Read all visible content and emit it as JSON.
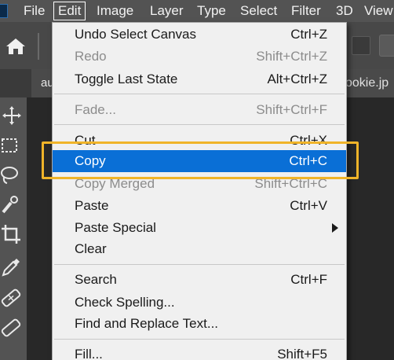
{
  "menubar": {
    "items": [
      {
        "label": "File",
        "active": false
      },
      {
        "label": "Edit",
        "active": true
      },
      {
        "label": "Image",
        "active": false
      },
      {
        "label": "Layer",
        "active": false
      },
      {
        "label": "Type",
        "active": false
      },
      {
        "label": "Select",
        "active": false
      },
      {
        "label": "Filter",
        "active": false
      },
      {
        "label": "3D",
        "active": false
      },
      {
        "label": "View",
        "active": false
      }
    ]
  },
  "tabs": {
    "left_label": "au",
    "right_label": "ookie.jp"
  },
  "toolbar": {
    "tools": [
      "move-tool-icon",
      "marquee-tool-icon",
      "lasso-tool-icon",
      "quick-selection-tool-icon",
      "crop-tool-icon",
      "eyedropper-tool-icon",
      "healing-brush-tool-icon",
      "brush-tool-icon"
    ]
  },
  "edit_menu": {
    "items": [
      {
        "label": "Undo Select Canvas",
        "shortcut": "Ctrl+Z",
        "enabled": true
      },
      {
        "label": "Redo",
        "shortcut": "Shift+Ctrl+Z",
        "enabled": false
      },
      {
        "label": "Toggle Last State",
        "shortcut": "Alt+Ctrl+Z",
        "enabled": true
      },
      {
        "label": "Fade...",
        "shortcut": "Shift+Ctrl+F",
        "enabled": false
      },
      {
        "label": "Cut",
        "shortcut": "Ctrl+X",
        "enabled": true
      },
      {
        "label": "Copy",
        "shortcut": "Ctrl+C",
        "enabled": true,
        "highlighted": true
      },
      {
        "label": "Copy Merged",
        "shortcut": "Shift+Ctrl+C",
        "enabled": false
      },
      {
        "label": "Paste",
        "shortcut": "Ctrl+V",
        "enabled": true
      },
      {
        "label": "Paste Special",
        "shortcut": "",
        "enabled": true,
        "submenu": true
      },
      {
        "label": "Clear",
        "shortcut": "",
        "enabled": true
      },
      {
        "label": "Search",
        "shortcut": "Ctrl+F",
        "enabled": true
      },
      {
        "label": "Check Spelling...",
        "shortcut": "",
        "enabled": true
      },
      {
        "label": "Find and Replace Text...",
        "shortcut": "",
        "enabled": true
      },
      {
        "label": "Fill...",
        "shortcut": "Shift+F5",
        "enabled": true
      }
    ]
  },
  "colors": {
    "highlight": "#0a6fd6",
    "callout": "#f0b429",
    "menu_bg": "#f0f0f0",
    "menubar_bg": "#535353"
  }
}
